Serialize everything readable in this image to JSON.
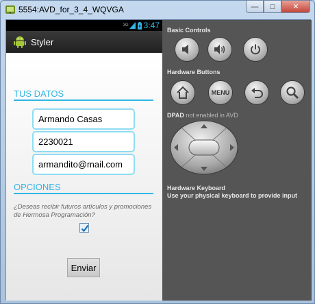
{
  "window": {
    "title": "5554:AVD_for_3_4_WQVGA",
    "minimize_glyph": "—",
    "maximize_glyph": "□",
    "close_glyph": "✕"
  },
  "statusbar": {
    "signal_label": "3G",
    "time": "3:47"
  },
  "app": {
    "title": "Styler",
    "section_user": "TUS DATOS",
    "name_value": "Armando Casas",
    "phone_value": "2230021",
    "email_value": "armandito@mail.com",
    "section_options": "OPCIONES",
    "question": "¿Deseas recibir futuros artículos y promociones de Hermosa Programación?",
    "newsletter_checked": true,
    "send_label": "Enviar"
  },
  "panel": {
    "basic_controls": "Basic Controls",
    "hardware_buttons": "Hardware Buttons",
    "menu_label": "MENU",
    "dpad_heading": "DPAD",
    "dpad_note": "not enabled in AVD",
    "keyboard_heading": "Hardware Keyboard",
    "keyboard_note": "Use your physical keyboard to provide input",
    "icons": [
      "volume-down-icon",
      "volume-up-icon",
      "power-icon",
      "home-icon",
      "back-icon",
      "search-icon"
    ]
  }
}
